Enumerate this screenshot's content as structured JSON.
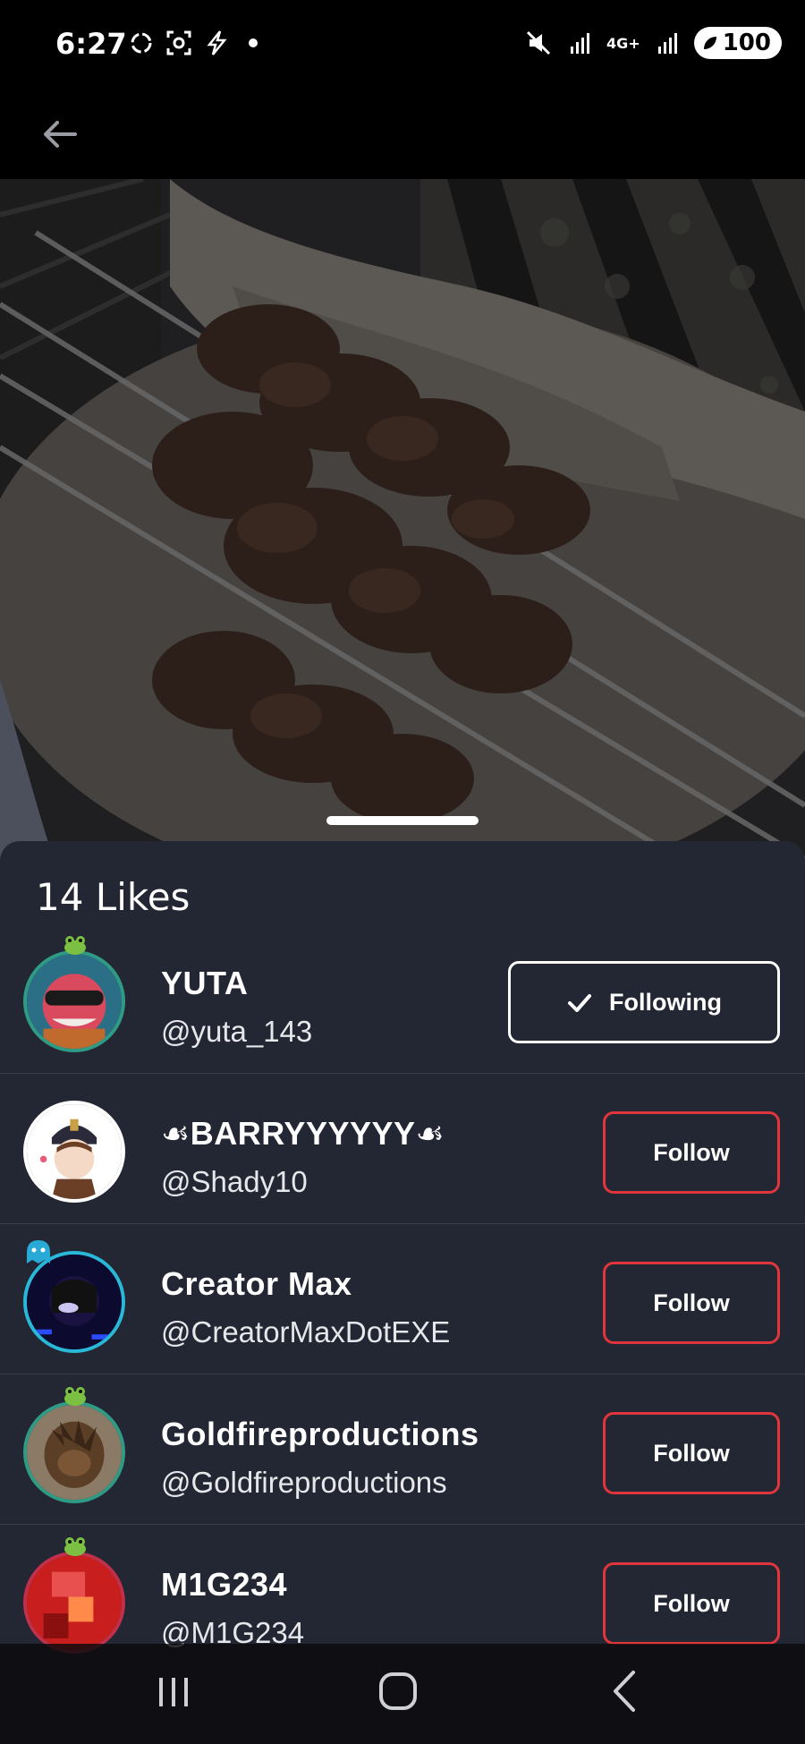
{
  "status_bar": {
    "time": "6:27",
    "battery": "100",
    "network": "4G+"
  },
  "top_bar": {
    "back_icon": "arrow-left-icon"
  },
  "sheet": {
    "title": "14 Likes",
    "users": [
      {
        "name": "YUTA",
        "handle": "@yuta_143",
        "button": "Following",
        "state": "following"
      },
      {
        "name": "☙BARRYYYYYY☙",
        "handle": "@Shady10",
        "button": "Follow",
        "state": "not-following"
      },
      {
        "name": "Creator Max",
        "handle": "@CreatorMaxDotEXE",
        "button": "Follow",
        "state": "not-following"
      },
      {
        "name": "Goldfireproductions",
        "handle": "@Goldfireproductions",
        "button": "Follow",
        "state": "not-following"
      },
      {
        "name": "M1G234",
        "handle": "@M1G234",
        "button": "Follow",
        "state": "not-following"
      }
    ]
  },
  "colors": {
    "sheet_bg": "#232633",
    "follow_border": "#e0353b",
    "following_border": "#ffffff",
    "avatar_ring": "#2f9b84"
  },
  "nav_bar": {
    "recents_icon": "recents-icon",
    "home_icon": "home-icon",
    "back_icon": "nav-back-icon"
  }
}
